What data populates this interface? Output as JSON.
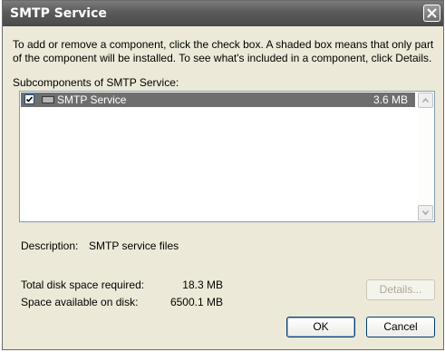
{
  "window": {
    "title": "SMTP Service"
  },
  "intro": "To add or remove a component, click the check box. A shaded box means that only part of the component will be installed. To see what's included in a component, click Details.",
  "subcomponents": {
    "label": "Subcomponents of SMTP Service:",
    "items": [
      {
        "name": "SMTP Service",
        "size": "3.6 MB",
        "checked": true,
        "selected": true
      }
    ]
  },
  "description": {
    "label": "Description:",
    "value": "SMTP service files"
  },
  "disk": {
    "required_label": "Total disk space required:",
    "required_value": "18.3 MB",
    "available_label": "Space available on disk:",
    "available_value": "6500.1 MB"
  },
  "buttons": {
    "details": "Details...",
    "ok": "OK",
    "cancel": "Cancel"
  },
  "icons": {
    "close": "close-icon",
    "checkmark": "checkmark-icon",
    "component": "component-icon",
    "scroll_up": "scroll-up-arrow-icon",
    "scroll_down": "scroll-down-arrow-icon"
  }
}
